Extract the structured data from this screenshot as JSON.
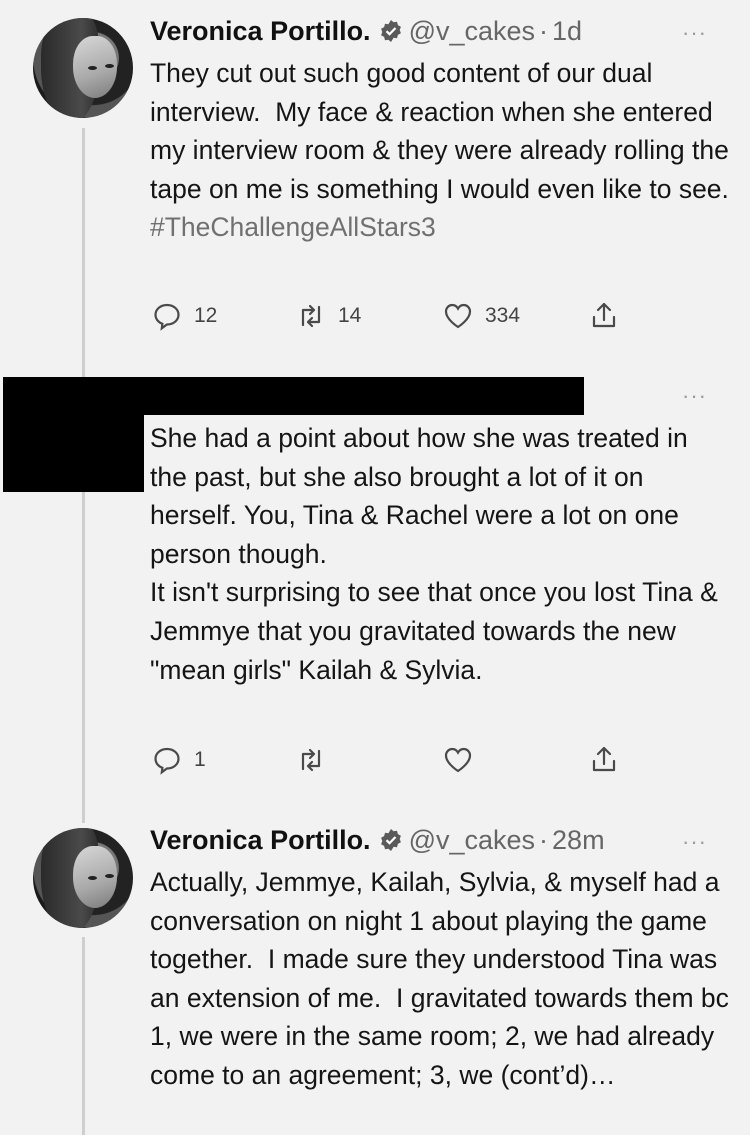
{
  "tweets": [
    {
      "name": "Veronica Portillo.",
      "handle": "@v_cakes",
      "separator": "·",
      "time": "1d",
      "more": "···",
      "text": "They cut out such good content of our dual interview.  My face & reaction when she entered my interview room & they were already rolling the tape on me is something I would even like to see.",
      "hashtag": "#TheChallengeAllStars3",
      "replies": "12",
      "retweets": "14",
      "likes": "334"
    },
    {
      "more": "···",
      "text": "She had a point about how she was treated in the past, but she also brought a lot of it on herself. You, Tina & Rachel were a lot on one person though.\nIt isn't surprising to see that once you lost Tina & Jemmye that you gravitated towards the new \"mean girls\" Kailah & Sylvia.",
      "replies": "1",
      "retweets": "",
      "likes": ""
    },
    {
      "name": "Veronica Portillo.",
      "handle": "@v_cakes",
      "separator": "·",
      "time": "28m",
      "more": "···",
      "text": "Actually, Jemmye, Kailah, Sylvia, & myself had a conversation on night 1 about playing the game together.  I made sure they understood Tina was an extension of me.  I gravitated towards them bc 1, we were in the same room; 2, we had already come to an agreement; 3, we (cont’d)…"
    }
  ],
  "icons": [
    "reply-icon",
    "retweet-icon",
    "like-icon",
    "share-icon",
    "verified-icon",
    "more-icon"
  ],
  "colors": {
    "background": "#f2f2f2",
    "text": "#151515",
    "muted": "#666666",
    "thread_line": "#cfcfcf",
    "redaction": "#000000"
  }
}
